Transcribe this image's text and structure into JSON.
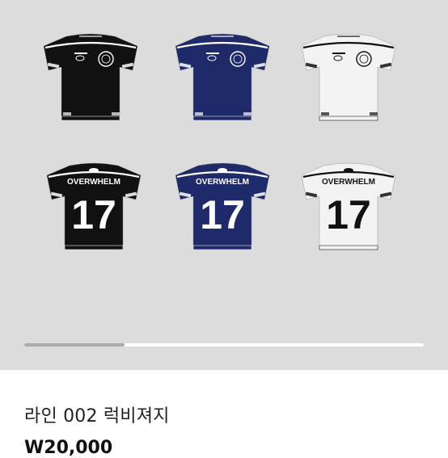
{
  "gallery": {
    "page_progress": 0.25,
    "shirts": [
      {
        "row": "back-design",
        "color": "#111111",
        "trim": "#ffffff",
        "ink": "#ffffff"
      },
      {
        "row": "back-design",
        "color": "#1f2a6b",
        "trim": "#ffffff",
        "ink": "#ffffff"
      },
      {
        "row": "back-design",
        "color": "#f3f3f3",
        "trim": "#111111",
        "ink": "#111111"
      },
      {
        "row": "front-design",
        "color": "#111111",
        "trim": "#ffffff",
        "ink": "#ffffff",
        "text": "OVERWHELM",
        "number": "17"
      },
      {
        "row": "front-design",
        "color": "#1f2a6b",
        "trim": "#ffffff",
        "ink": "#ffffff",
        "text": "OVERWHELM",
        "number": "17"
      },
      {
        "row": "front-design",
        "color": "#f3f3f3",
        "trim": "#111111",
        "ink": "#111111",
        "text": "OVERWHELM",
        "number": "17"
      }
    ]
  },
  "product": {
    "title": "라인 002 럭비져지",
    "price": "W20,000"
  }
}
